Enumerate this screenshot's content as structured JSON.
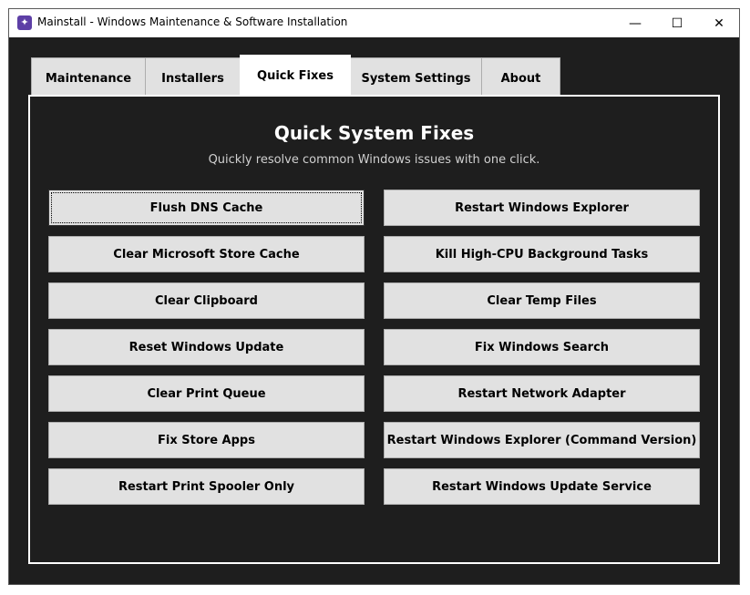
{
  "window": {
    "title": "Mainstall - Windows Maintenance & Software Installation",
    "controls": {
      "minimize": "—",
      "maximize": "☐",
      "close": "✕"
    }
  },
  "tabs": [
    {
      "label": "Maintenance",
      "active": false
    },
    {
      "label": "Installers",
      "active": false
    },
    {
      "label": "Quick Fixes",
      "active": true
    },
    {
      "label": "System Settings",
      "active": false
    },
    {
      "label": "About",
      "active": false
    }
  ],
  "panel": {
    "title": "Quick System Fixes",
    "subtitle": "Quickly resolve common Windows issues with one click."
  },
  "buttons": [
    {
      "label": "Flush DNS Cache"
    },
    {
      "label": "Restart Windows Explorer"
    },
    {
      "label": "Clear Microsoft Store Cache"
    },
    {
      "label": "Kill High-CPU Background Tasks"
    },
    {
      "label": "Clear Clipboard"
    },
    {
      "label": "Clear Temp Files"
    },
    {
      "label": "Reset Windows Update"
    },
    {
      "label": "Fix Windows Search"
    },
    {
      "label": "Clear Print Queue"
    },
    {
      "label": "Restart Network Adapter"
    },
    {
      "label": "Fix Store Apps"
    },
    {
      "label": "Restart Windows Explorer (Command Version)"
    },
    {
      "label": "Restart Print Spooler Only"
    },
    {
      "label": "Restart Windows Update Service"
    }
  ],
  "colors": {
    "window_bg": "#1e1e1e",
    "button_bg": "#e1e1e1",
    "accent_icon": "#5d3fa6"
  }
}
